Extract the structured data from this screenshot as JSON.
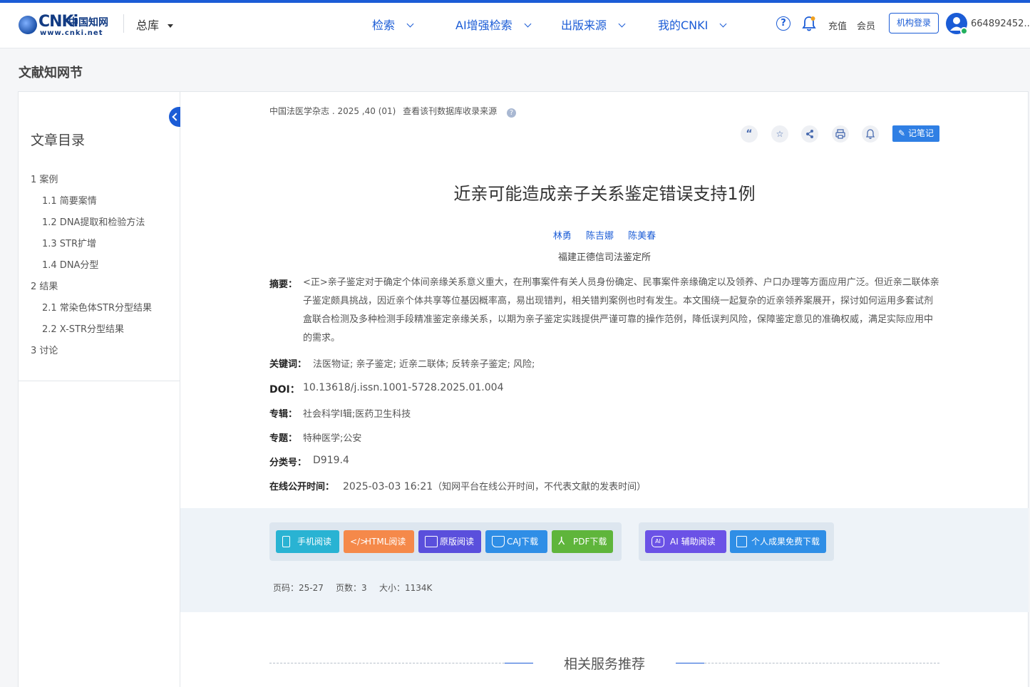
{
  "header": {
    "logo_text": "CNKi",
    "logo_cn": "中国知网",
    "logo_url": "www.cnki.net",
    "db_select": "总库",
    "nav": [
      "检索",
      "AI增强检索",
      "出版来源",
      "我的CNKI"
    ],
    "recharge": "充值",
    "member": "会员",
    "institution_login": "机构登录",
    "username": "664892452..."
  },
  "page": {
    "section_title": "文献知网节"
  },
  "toc": {
    "title": "文章目录",
    "items": [
      "1 案例",
      "1.1 简要案情",
      "1.2 DNA提取和检验方法",
      "1.3 STR扩增",
      "1.4 DNA分型",
      "2 结果",
      "2.1 常染色体STR分型结果",
      "2.2 X-STR分型结果",
      "3 讨论"
    ]
  },
  "article": {
    "source": "中国法医学杂志 . 2025 ,40 (01)",
    "source_link": "查看该刊数据库收录来源",
    "note_button": "记笔记",
    "title": "近亲可能造成亲子关系鉴定错误支持1例",
    "authors": [
      "林勇",
      "陈吉娜",
      "陈美春"
    ],
    "affiliation": "福建正德信司法鉴定所",
    "abstract_label": "摘要：",
    "abstract": "<正>亲子鉴定对于确定个体间亲缘关系意义重大，在刑事案件有关人员身份确定、民事案件亲缘确定以及领养、户口办理等方面应用广泛。但近亲二联体亲子鉴定颇具挑战，因近亲个体共享等位基因概率高，易出现错判，相关错判案例也时有发生。本文围绕一起复杂的近亲领养案展开，探讨如何运用多套试剂盒联合检测及多种检测手段精准鉴定亲缘关系，以期为亲子鉴定实践提供严谨可靠的操作范例，降低误判风险，保障鉴定意见的准确权威，满足实际应用中的需求。",
    "keywords_label": "关键词：",
    "keywords": "法医物证;  亲子鉴定;  近亲二联体;  反转亲子鉴定;  风险;",
    "doi_label": "DOI：",
    "doi": "10.13618/j.issn.1001-5728.2025.01.004",
    "series_label": "专辑：",
    "series": "社会科学Ⅰ辑;医药卫生科技",
    "topic_label": "专题：",
    "topic": "特种医学;公安",
    "class_label": "分类号：",
    "class": "D919.4",
    "online_label": "在线公开时间：",
    "online_time": "2025-03-03 16:21",
    "online_note": "（知网平台在线公开时间，不代表文献的发表时间）"
  },
  "actions": {
    "mobile": "手机阅读",
    "html": "HTML阅读",
    "original": "原版阅读",
    "caj": "CAJ下载",
    "pdf": "PDF下载",
    "ai": "AI 辅助阅读",
    "personal": "个人成果免费下载"
  },
  "meta": {
    "pages": "页码：25-27",
    "page_count": "页数：3",
    "size": "大小：1134K"
  },
  "related": {
    "title": "相关服务推荐"
  },
  "colors": {
    "brand_blue": "#1b5cd6",
    "btn_mobile": "#29b3d3",
    "btn_html": "#f5894a",
    "btn_original": "#5a4fdc",
    "btn_caj": "#2f8ee6",
    "btn_pdf": "#5fb53b",
    "btn_ai": "#6b52e6",
    "btn_personal": "#2f8ee6"
  }
}
